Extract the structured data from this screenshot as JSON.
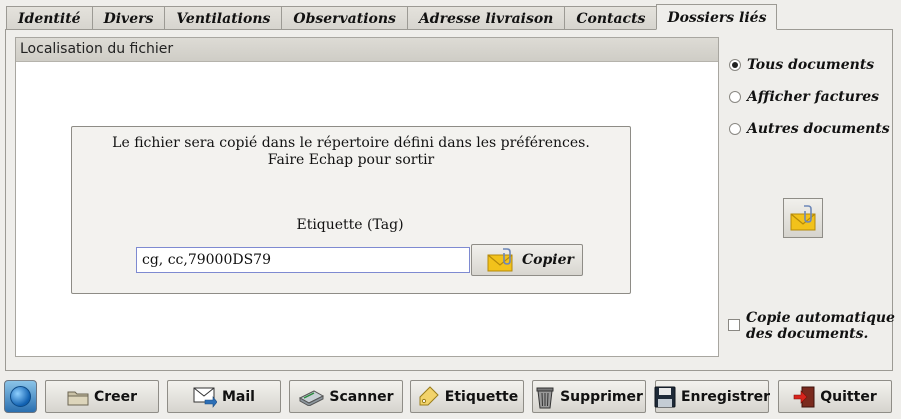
{
  "tabs": [
    {
      "label": "Identité",
      "active": false
    },
    {
      "label": "Divers",
      "active": false
    },
    {
      "label": "Ventilations",
      "active": false
    },
    {
      "label": "Observations",
      "active": false
    },
    {
      "label": "Adresse livraison",
      "active": false
    },
    {
      "label": "Contacts",
      "active": false
    },
    {
      "label": "Dossiers liés",
      "active": true
    }
  ],
  "location_panel": {
    "header": "Localisation du fichier",
    "message_line1": "Le fichier sera copié dans le répertoire défini dans les préférences.",
    "message_line2": "Faire Echap pour sortir",
    "tag_label": "Etiquette (Tag)",
    "tag_value": "cg, cc,79000DS79",
    "copy_button": "Copier"
  },
  "filters": [
    {
      "label": "Tous documents",
      "checked": true
    },
    {
      "label": "Afficher factures",
      "checked": false
    },
    {
      "label": "Autres documents",
      "checked": false
    }
  ],
  "auto_copy": {
    "label_line1": "Copie automatique",
    "label_line2": "des documents.",
    "checked": false
  },
  "toolbar": {
    "create": "Creer",
    "mail": "Mail",
    "scanner": "Scanner",
    "label": "Etiquette",
    "delete": "Supprimer",
    "save": "Enregistrer",
    "quit": "Quitter"
  },
  "colors": {
    "accent_input_border": "#7e8ad1",
    "envelope_yellow": "#f2c21b"
  }
}
